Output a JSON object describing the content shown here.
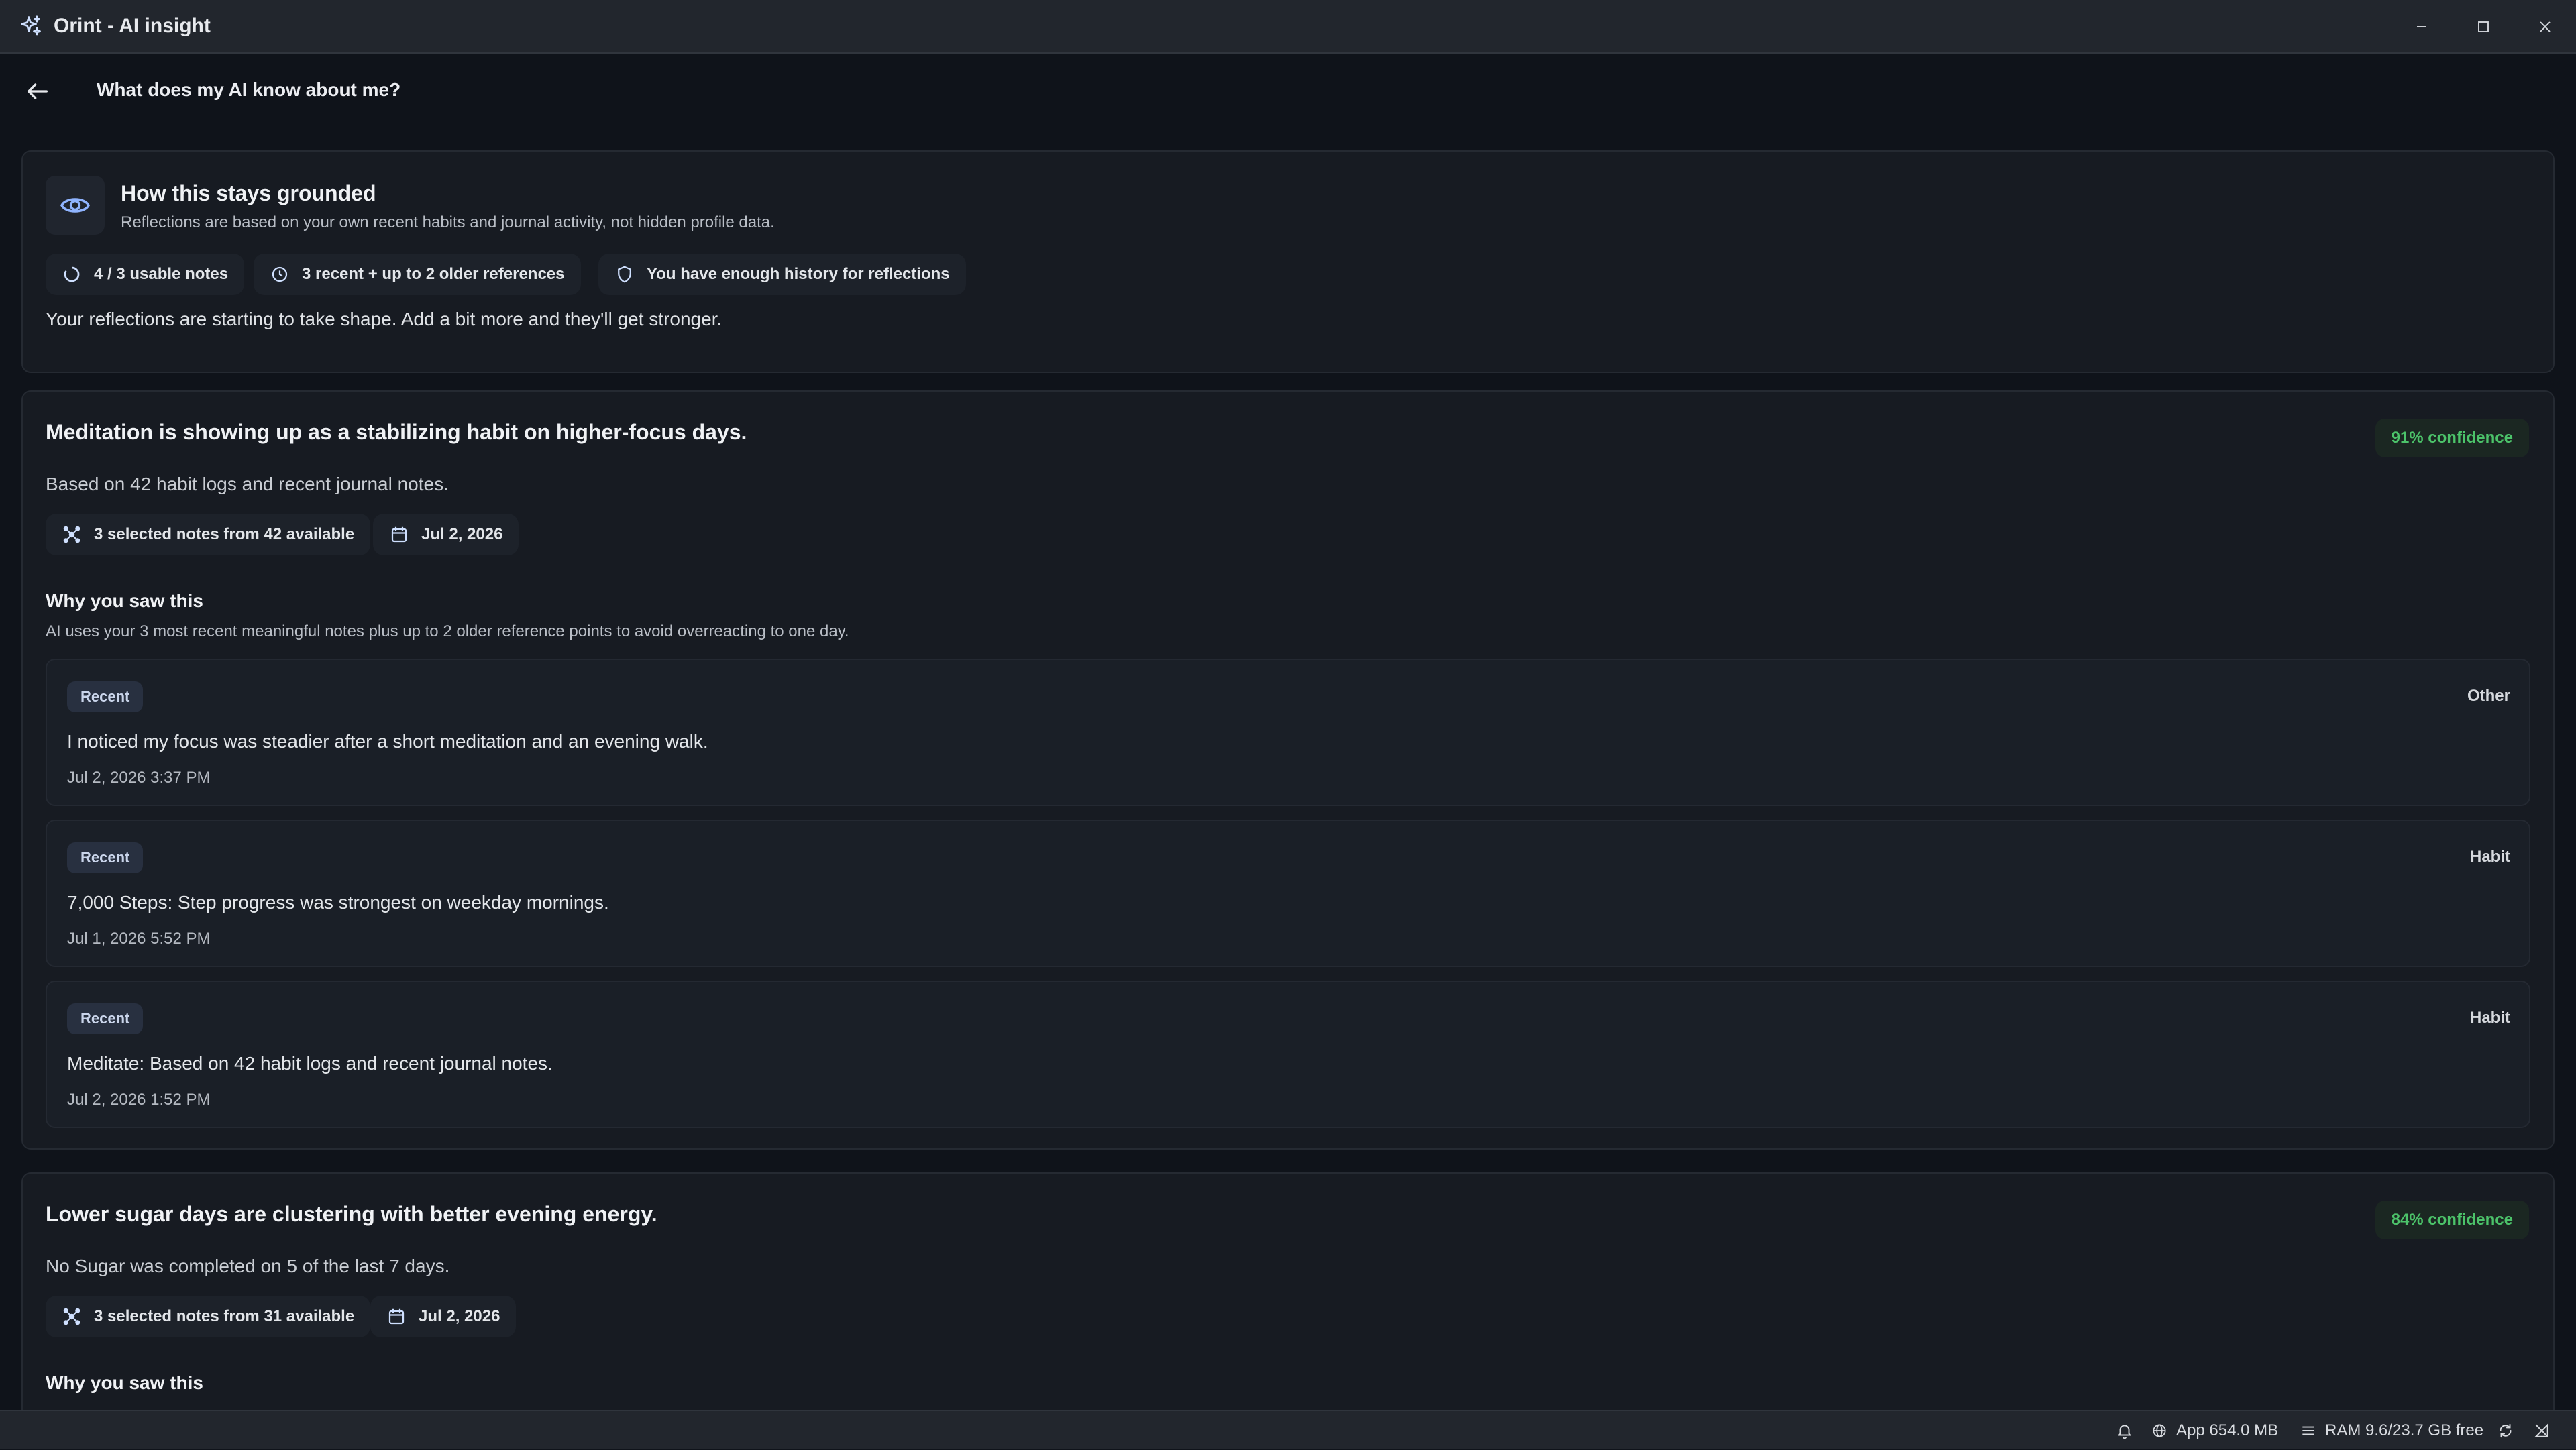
{
  "window": {
    "title": "Orint - AI insight",
    "minimize_icon": "minimize-icon",
    "maximize_icon": "maximize-icon",
    "close_icon": "close-icon"
  },
  "header": {
    "back_icon": "arrow-left-icon",
    "title": "What does my AI know about me?"
  },
  "grounded": {
    "icon": "eye-icon",
    "title": "How this stays grounded",
    "subtitle": "Reflections are based on your own recent habits and journal activity, not hidden profile data.",
    "chips": [
      {
        "icon": "progress-ring-icon",
        "label": "4 / 3 usable notes"
      },
      {
        "icon": "clock-icon",
        "label": "3 recent + up to 2 older references"
      },
      {
        "icon": "shield-icon",
        "label": "You have enough history for reflections"
      }
    ],
    "message": "Your reflections are starting to take shape. Add a bit more and they'll get stronger."
  },
  "insights": [
    {
      "title": "Meditation is showing up as a stabilizing habit on higher-focus days.",
      "confidence": "91% confidence",
      "description": "Based on 42 habit logs and recent journal notes.",
      "sources_chip": "3 selected notes from 42 available",
      "date_chip": "Jul 2, 2026",
      "why_title": "Why you saw this",
      "why_subtitle": "AI uses your 3 most recent meaningful notes plus up to 2 older reference points to avoid overreacting to one day.",
      "notes": [
        {
          "tag": "Recent",
          "type": "Other",
          "text": "I noticed my focus was steadier after a short meditation and an evening walk.",
          "time": "Jul 2, 2026 3:37 PM"
        },
        {
          "tag": "Recent",
          "type": "Habit",
          "text": "7,000 Steps: Step progress was strongest on weekday mornings.",
          "time": "Jul 1, 2026 5:52 PM"
        },
        {
          "tag": "Recent",
          "type": "Habit",
          "text": "Meditate: Based on 42 habit logs and recent journal notes.",
          "time": "Jul 2, 2026 1:52 PM"
        }
      ]
    },
    {
      "title": "Lower sugar days are clustering with better evening energy.",
      "confidence": "84% confidence",
      "description": "No Sugar was completed on 5 of the last 7 days.",
      "sources_chip": "3 selected notes from 31 available",
      "date_chip": "Jul 2, 2026",
      "why_title": "Why you saw this"
    }
  ],
  "status": {
    "bell_icon": "bell-icon",
    "app_memory": "App 654.0 MB",
    "ram": "RAM 9.6/23.7 GB free",
    "sync_icon": "sync-icon",
    "network_icon": "network-icon"
  }
}
